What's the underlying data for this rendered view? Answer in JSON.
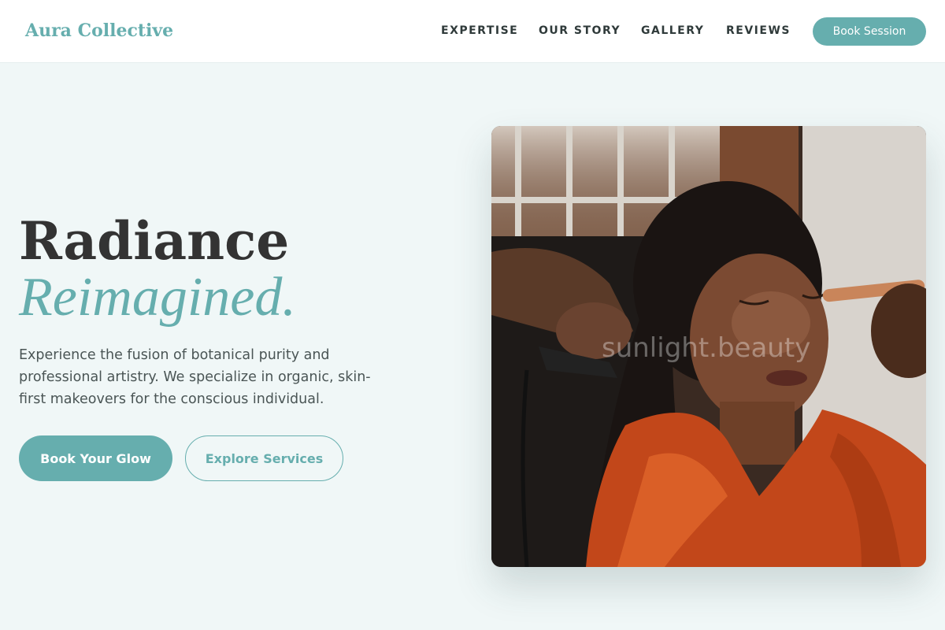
{
  "header": {
    "brand": "Aura Collective",
    "nav": [
      "EXPERTISE",
      "OUR STORY",
      "GALLERY",
      "REVIEWS"
    ],
    "cta": "Book Session"
  },
  "hero": {
    "title_line1": "Radiance",
    "title_line2": "Reimagined.",
    "description": "Experience the fusion of botanical purity and professional artistry. We specialize in organic, skin-first makeovers for the conscious individual.",
    "primary_button": "Book Your Glow",
    "secondary_button": "Explore Services",
    "image_watermark": "sunlight.beauty"
  },
  "colors": {
    "accent": "#66aeae",
    "background": "#f0f7f7",
    "text": "#333333"
  }
}
